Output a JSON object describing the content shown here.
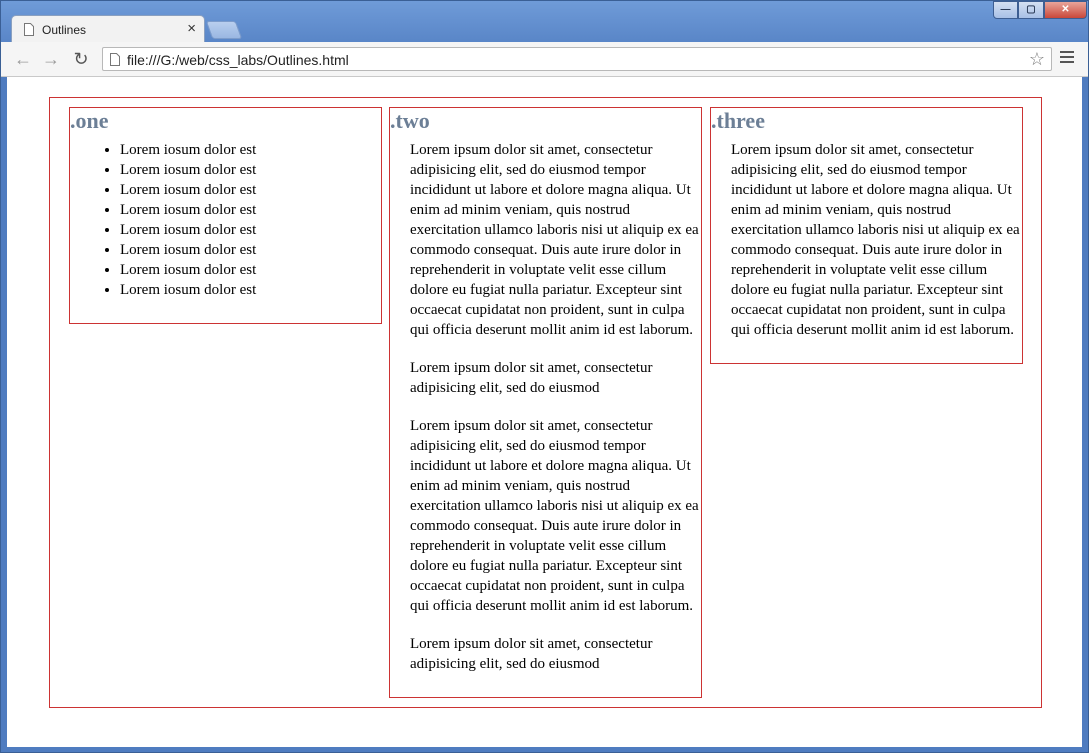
{
  "browser": {
    "tab_title": "Outlines",
    "tab_close": "×",
    "url": "file:///G:/web/css_labs/Outlines.html",
    "window_controls": [
      "—",
      "▢",
      "✕"
    ],
    "nav": {
      "back": "←",
      "forward": "→",
      "reload": "↻"
    },
    "star": "☆"
  },
  "page": {
    "one": {
      "heading": ".one",
      "items": [
        "Lorem iosum dolor est",
        "Lorem iosum dolor est",
        "Lorem iosum dolor est",
        "Lorem iosum dolor est",
        "Lorem iosum dolor est",
        "Lorem iosum dolor est",
        "Lorem iosum dolor est",
        "Lorem iosum dolor est"
      ]
    },
    "two": {
      "heading": ".two",
      "paragraphs": [
        "Lorem ipsum dolor sit amet, consectetur adipisicing elit, sed do eiusmod tempor incididunt ut labore et dolore magna aliqua. Ut enim ad minim veniam, quis nostrud exercitation ullamco laboris nisi ut aliquip ex ea commodo consequat. Duis aute irure dolor in reprehenderit in voluptate velit esse cillum dolore eu fugiat nulla pariatur. Excepteur sint occaecat cupidatat non proident, sunt in culpa qui officia deserunt mollit anim id est laborum.",
        "Lorem ipsum dolor sit amet, consectetur adipisicing elit, sed do eiusmod",
        "Lorem ipsum dolor sit amet, consectetur adipisicing elit, sed do eiusmod tempor incididunt ut labore et dolore magna aliqua. Ut enim ad minim veniam, quis nostrud exercitation ullamco laboris nisi ut aliquip ex ea commodo consequat. Duis aute irure dolor in reprehenderit in voluptate velit esse cillum dolore eu fugiat nulla pariatur. Excepteur sint occaecat cupidatat non proident, sunt in culpa qui officia deserunt mollit anim id est laborum.",
        "Lorem ipsum dolor sit amet, consectetur adipisicing elit, sed do eiusmod"
      ]
    },
    "three": {
      "heading": ".three",
      "paragraphs": [
        "Lorem ipsum dolor sit amet, consectetur adipisicing elit, sed do eiusmod tempor incididunt ut labore et dolore magna aliqua. Ut enim ad minim veniam, quis nostrud exercitation ullamco laboris nisi ut aliquip ex ea commodo consequat. Duis aute irure dolor in reprehenderit in voluptate velit esse cillum dolore eu fugiat nulla pariatur. Excepteur sint occaecat cupidatat non proident, sunt in culpa qui officia deserunt mollit anim id est laborum."
      ]
    }
  },
  "colors": {
    "outline": "#cc3333",
    "heading": "#6c7f96",
    "chrome_frame": "#4f7cc0"
  }
}
